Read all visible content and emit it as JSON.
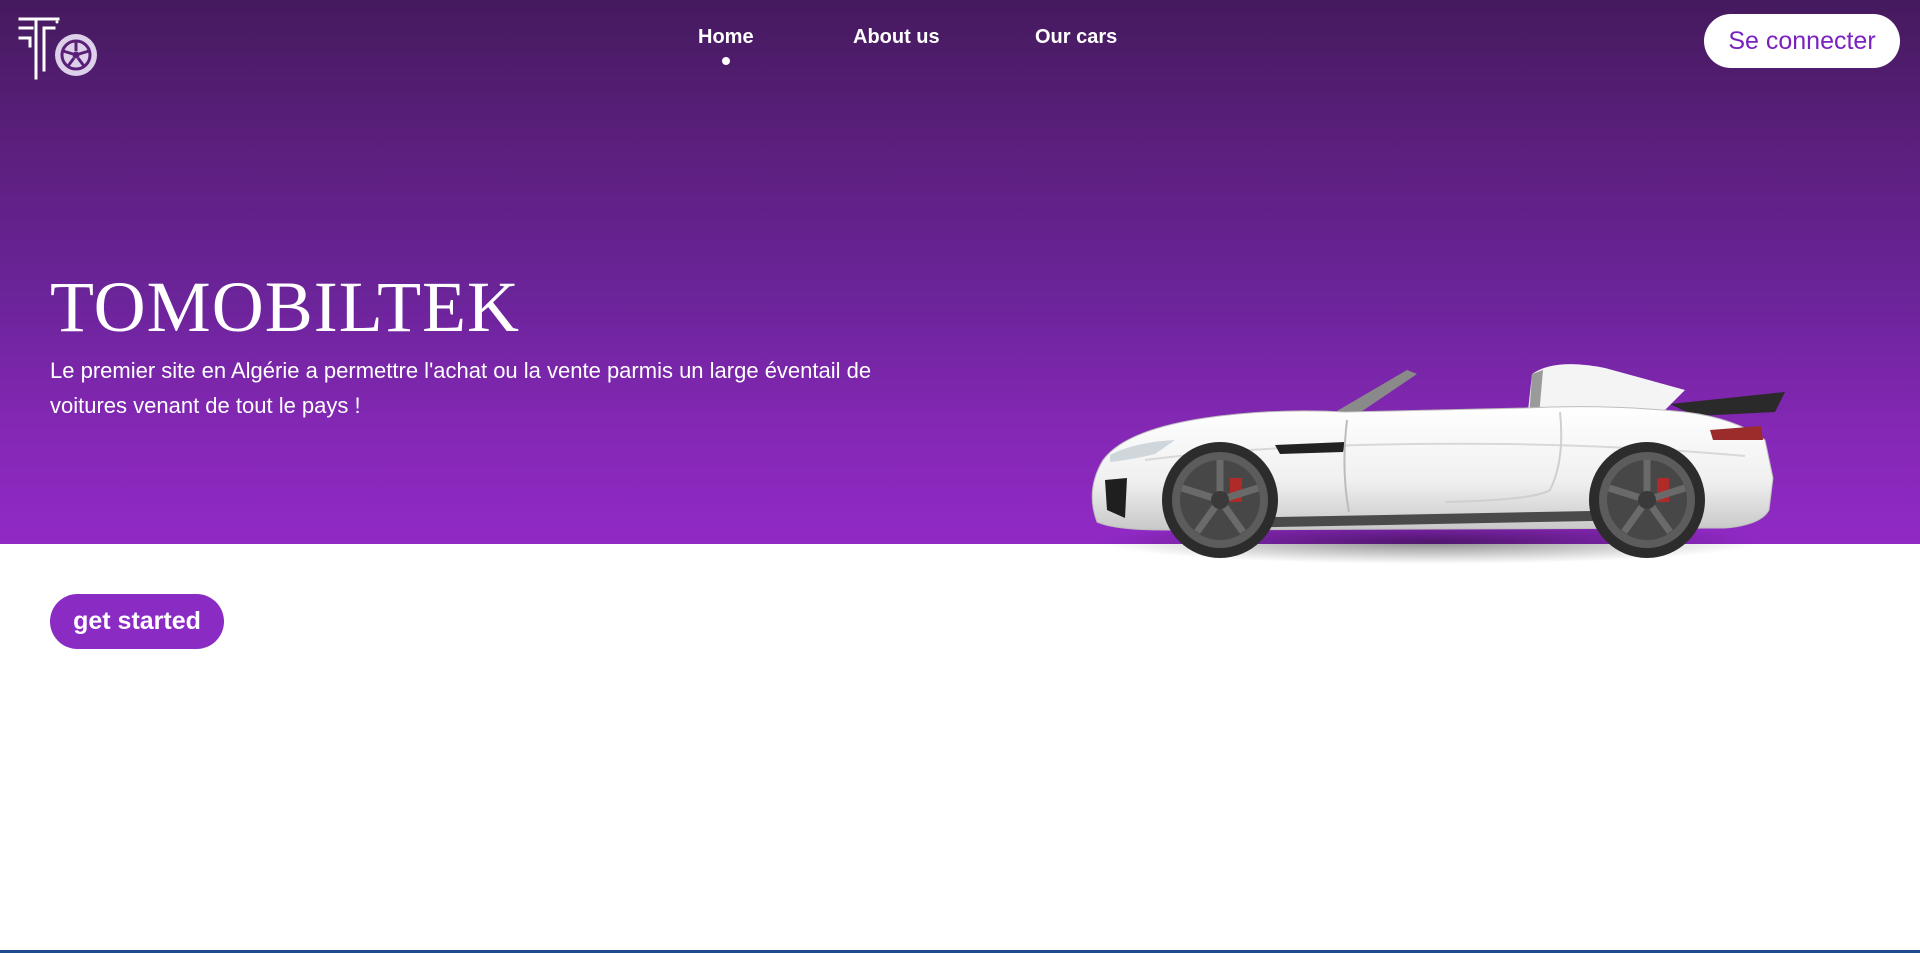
{
  "header": {
    "logo_icon": "wheel-logo-icon",
    "nav": {
      "home": "Home",
      "about": "About us",
      "cars": "Our cars",
      "active": "Home"
    },
    "login_label": "Se connecter"
  },
  "hero": {
    "title": "TOMOBILTEK",
    "subtitle": "Le premier site en Algérie a permettre l'achat ou la vente parmis un large éventail de voitures venant de tout le pays !",
    "image": "white-convertible-sports-car"
  },
  "cta": {
    "label": "get started"
  },
  "colors": {
    "hero_top": "#451a5e",
    "hero_bottom": "#9129c5",
    "accent": "#8a2bc4",
    "login_text": "#7a22c0"
  }
}
